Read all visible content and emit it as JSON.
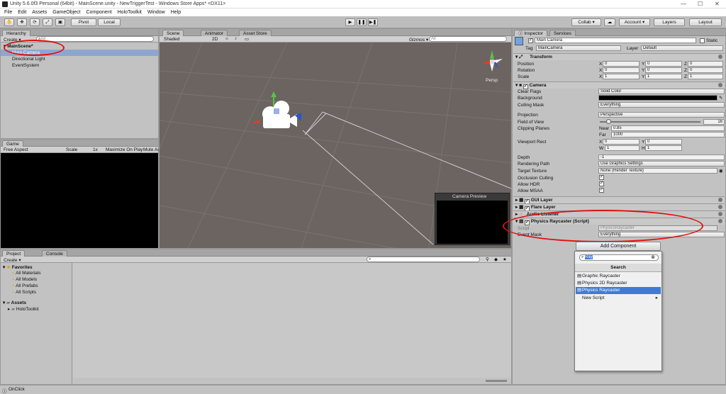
{
  "window": {
    "title": "Unity 5.6.0f3 Personal (64bit) - MainScene.unity - NewTriggerTest - Windows Store Apps* <DX11>"
  },
  "menu": [
    "File",
    "Edit",
    "Assets",
    "GameObject",
    "Component",
    "HoloToolkit",
    "Window",
    "Help"
  ],
  "toolbar": {
    "pivot": "Pivot",
    "local": "Local",
    "collab": "Collab ▾",
    "account": "Account ▾",
    "layers": "Layers",
    "layout": "Layout"
  },
  "hierarchy": {
    "tab": "Hierarchy",
    "create": "Create ▾",
    "search_placeholder": "All",
    "scene": "MainScene*",
    "items": [
      "Main Camera",
      "Directional Light",
      "EventSystem"
    ]
  },
  "scene_view": {
    "tabs": [
      "Scene",
      "Animator",
      "Asset Store"
    ],
    "shaded": "Shaded",
    "mode2d": "2D",
    "gizmos": "Gizmos ▾",
    "gizmo_search": "All",
    "persp": "Persp",
    "camera_preview": "Camera Preview"
  },
  "game_view": {
    "tab": "Game",
    "aspect": "Free Aspect",
    "scale": "Scale",
    "scale_val": "1x",
    "maximize": "Maximize On Play",
    "mute": "Mute Au"
  },
  "project": {
    "tabs": [
      "Project",
      "Console"
    ],
    "create": "Create ▾",
    "favorites": "Favorites",
    "fav_items": [
      "All Materials",
      "All Models",
      "All Prefabs",
      "All Scripts"
    ],
    "assets": "Assets",
    "asset_items": [
      "HoloToolkit"
    ]
  },
  "statusbar": {
    "text": "OnClick"
  },
  "inspector": {
    "tabs": [
      "Inspector",
      "Services"
    ],
    "object_name": "Main Camera",
    "static": "Static",
    "tag_label": "Tag",
    "tag": "MainCamera",
    "layer_label": "Layer",
    "layer": "Default",
    "transform": {
      "title": "Transform",
      "rows": [
        {
          "label": "Position",
          "x": "0",
          "y": "0",
          "z": "0"
        },
        {
          "label": "Rotation",
          "x": "0",
          "y": "0",
          "z": "0"
        },
        {
          "label": "Scale",
          "x": "1",
          "y": "1",
          "z": "1"
        }
      ]
    },
    "camera": {
      "title": "Camera",
      "clear_flags_label": "Clear Flags",
      "clear_flags": "Solid Color",
      "background_label": "Background",
      "culling_label": "Culling Mask",
      "culling": "Everything",
      "projection_label": "Projection",
      "projection": "Perspective",
      "fov_label": "Field of View",
      "fov": "16",
      "fov_fraction": 0.08,
      "clipping_label": "Clipping Planes",
      "near_label": "Near",
      "near": "0.85",
      "far_label": "Far",
      "far": "1000",
      "viewport_label": "Viewport Rect",
      "vx": "0",
      "vy": "0",
      "vw": "1",
      "vh": "1",
      "depth_label": "Depth",
      "depth": "-1",
      "rendering_label": "Rendering Path",
      "rendering": "Use Graphics Settings",
      "target_label": "Target Texture",
      "target": "None (Render Texture)",
      "occlusion_label": "Occlusion Culling",
      "hdr_label": "Allow HDR",
      "msaa_label": "Allow MSAA"
    },
    "components": [
      "GUI Layer",
      "Flare Layer",
      "Audio Listener"
    ],
    "raycaster": {
      "title": "Physics Raycaster (Script)",
      "script_label": "Script",
      "script": "PhysicsRaycaster",
      "mask_label": "Event Mask",
      "mask": "Everything"
    },
    "add_component": "Add Component",
    "popup": {
      "search_value": "Ray",
      "header": "Search",
      "items": [
        "Graphic Raycaster",
        "Physics 2D Raycaster",
        "Physics Raycaster",
        "New Script"
      ]
    }
  },
  "colors": {
    "accent": "#3d7bd6",
    "annotation": "#dd1111",
    "scene_bg": "#6b6460",
    "game_bg": "#000000"
  }
}
